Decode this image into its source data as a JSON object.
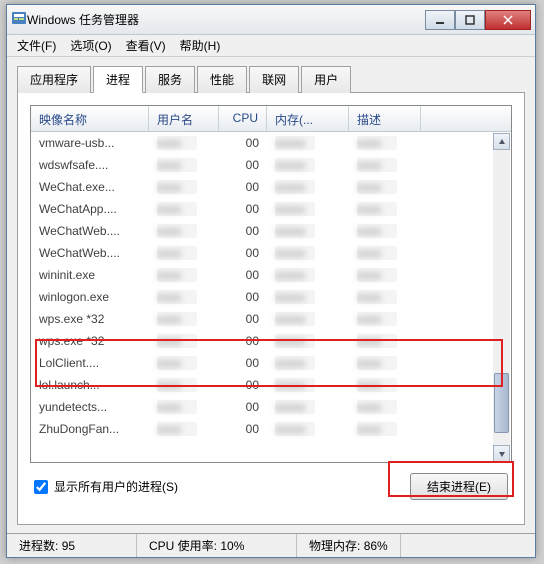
{
  "window": {
    "title": "Windows 任务管理器"
  },
  "menu": {
    "file": "文件(F)",
    "options": "选项(O)",
    "view": "查看(V)",
    "help": "帮助(H)"
  },
  "tabs": {
    "apps": "应用程序",
    "processes": "进程",
    "services": "服务",
    "performance": "性能",
    "networking": "联网",
    "users": "用户"
  },
  "columns": {
    "image_name": "映像名称",
    "user_name": "用户名",
    "cpu": "CPU",
    "memory": "内存(...",
    "description": "描述"
  },
  "processes": [
    {
      "name": "vmware-usb...",
      "cpu": "00"
    },
    {
      "name": "wdswfsafe....",
      "cpu": "00"
    },
    {
      "name": "WeChat.exe...",
      "cpu": "00"
    },
    {
      "name": "WeChatApp....",
      "cpu": "00"
    },
    {
      "name": "WeChatWeb....",
      "cpu": "00"
    },
    {
      "name": "WeChatWeb....",
      "cpu": "00"
    },
    {
      "name": "wininit.exe",
      "cpu": "00"
    },
    {
      "name": "winlogon.exe",
      "cpu": "00"
    },
    {
      "name": "wps.exe *32",
      "cpu": "00"
    },
    {
      "name": "wps.exe *32",
      "cpu": "00"
    },
    {
      "name": "LolClient....",
      "cpu": "00"
    },
    {
      "name": "lol.launch...",
      "cpu": "00"
    },
    {
      "name": "yundetects...",
      "cpu": "00"
    },
    {
      "name": "ZhuDongFan...",
      "cpu": "00"
    }
  ],
  "footer": {
    "show_all_label": "显示所有用户的进程(S)",
    "end_process": "结束进程(E)"
  },
  "status": {
    "process_count_label": "进程数:",
    "process_count_value": "95",
    "cpu_usage_label": "CPU 使用率:",
    "cpu_usage_value": "10%",
    "memory_label": "物理内存:",
    "memory_value": "86%"
  }
}
